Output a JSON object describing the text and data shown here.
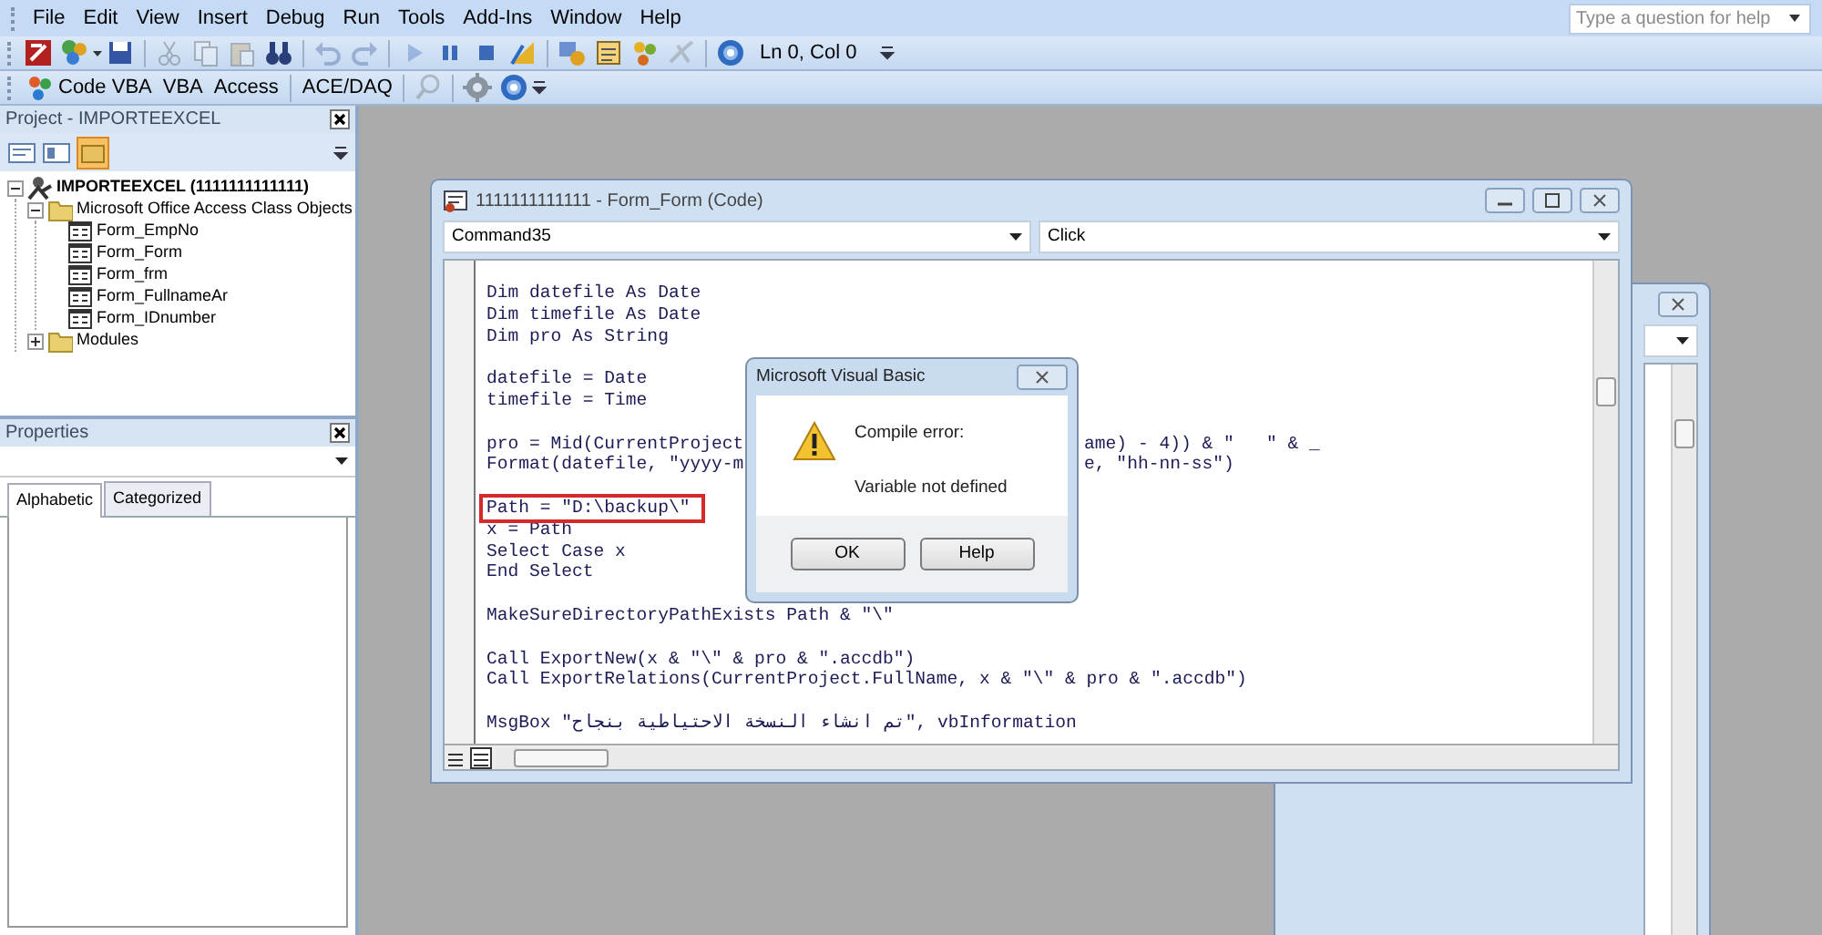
{
  "menu": [
    "File",
    "Edit",
    "View",
    "Insert",
    "Debug",
    "Run",
    "Tools",
    "Add-Ins",
    "Window",
    "Help"
  ],
  "help_search": {
    "placeholder": "Type a question for help"
  },
  "toolbar_standard": [
    {
      "kind": "app",
      "disabled": false
    },
    {
      "kind": "insert",
      "disabled": false
    },
    {
      "kind": "save",
      "disabled": false
    },
    {
      "kind": "separator"
    },
    {
      "kind": "cut",
      "disabled": true
    },
    {
      "kind": "copy",
      "disabled": true
    },
    {
      "kind": "paste",
      "disabled": true
    },
    {
      "kind": "find",
      "disabled": false
    },
    {
      "kind": "separator"
    },
    {
      "kind": "undo",
      "disabled": true
    },
    {
      "kind": "redo",
      "disabled": true
    },
    {
      "kind": "separator"
    },
    {
      "kind": "run",
      "disabled": true
    },
    {
      "kind": "pause",
      "disabled": false
    },
    {
      "kind": "stop",
      "disabled": false
    },
    {
      "kind": "design",
      "disabled": false
    },
    {
      "kind": "separator"
    },
    {
      "kind": "explorer",
      "disabled": false
    },
    {
      "kind": "properties",
      "disabled": false
    },
    {
      "kind": "browser",
      "disabled": false
    },
    {
      "kind": "toolbox",
      "disabled": true
    },
    {
      "kind": "separator"
    },
    {
      "kind": "help",
      "disabled": false
    }
  ],
  "cursor_position": "Ln 0, Col 0",
  "toolbar_custom": [
    {
      "kind": "labeled",
      "label": "Code VBA"
    },
    {
      "kind": "text",
      "label": "VBA"
    },
    {
      "kind": "text",
      "label": "Access"
    },
    {
      "kind": "separator"
    },
    {
      "kind": "text",
      "label": "ACE/DAQ"
    },
    {
      "kind": "separator"
    },
    {
      "kind": "search",
      "disabled": true
    },
    {
      "kind": "separator"
    },
    {
      "kind": "gear",
      "disabled": false
    },
    {
      "kind": "help",
      "disabled": false
    }
  ],
  "project": {
    "title": "Project - IMPORTEEXCEL",
    "view_buttons": [
      {
        "kind": "code",
        "selected": false
      },
      {
        "kind": "object",
        "selected": false
      },
      {
        "kind": "folders",
        "selected": true
      }
    ],
    "tree": [
      {
        "label": "IMPORTEEXCEL (1111111111111)",
        "kind": "project",
        "expanded": true,
        "children": [
          {
            "label": "Microsoft Office Access Class Objects",
            "kind": "folder",
            "expanded": true,
            "children": [
              {
                "label": "Form_EmpNo",
                "kind": "form"
              },
              {
                "label": "Form_Form",
                "kind": "form"
              },
              {
                "label": "Form_frm",
                "kind": "form"
              },
              {
                "label": "Form_FullnameAr",
                "kind": "form"
              },
              {
                "label": "Form_IDnumber",
                "kind": "form"
              }
            ]
          },
          {
            "label": "Modules",
            "kind": "folder",
            "expanded": false
          }
        ]
      }
    ]
  },
  "properties": {
    "title": "Properties",
    "tabs": [
      {
        "label": "Alphabetic",
        "selected": true
      },
      {
        "label": "Categorized",
        "selected": false
      }
    ]
  },
  "code_window": {
    "title": "1111111111111 - Form_Form (Code)",
    "object": "Command35",
    "procedure": "Click",
    "code_blocks": [
      [
        {
          "text": "Dim datefile As Date"
        },
        {
          "text": "Dim timefile As Date"
        },
        {
          "text": "Dim pro As String"
        }
      ],
      [
        {
          "text": "datefile = Date"
        },
        {
          "text": "timefile = Time"
        }
      ],
      [
        {
          "text": "pro = Mid(CurrentProject",
          "tail": "ame) - 4)) & \"   \" & _"
        },
        {
          "text": "Format(datefile, \"yyyy-m",
          "tail": "e, \"hh-nn-ss\")"
        }
      ],
      [
        {
          "text": "Path = \"D:\\backup\\\"",
          "highlighted": true
        },
        {
          "text": "x = Path"
        },
        {
          "text": "Select Case x"
        },
        {
          "text": "End Select"
        }
      ],
      [
        {
          "text": "MakeSureDirectoryPathExists Path & \"\\\""
        }
      ],
      [
        {
          "text": "Call ExportNew(x & \"\\\" & pro & \".accdb\")"
        },
        {
          "text": "Call ExportRelations(CurrentProject.FullName, x & \"\\\" & pro & \".accdb\")"
        }
      ],
      [
        {
          "text": "MsgBox \"تم انشاء النسخة الاحتياطية بنجاح\", vbInformation"
        }
      ]
    ]
  },
  "dialog": {
    "title": "Microsoft Visual Basic",
    "heading": "Compile error:",
    "message": "Variable not defined",
    "buttons": [
      "OK",
      "Help"
    ]
  }
}
